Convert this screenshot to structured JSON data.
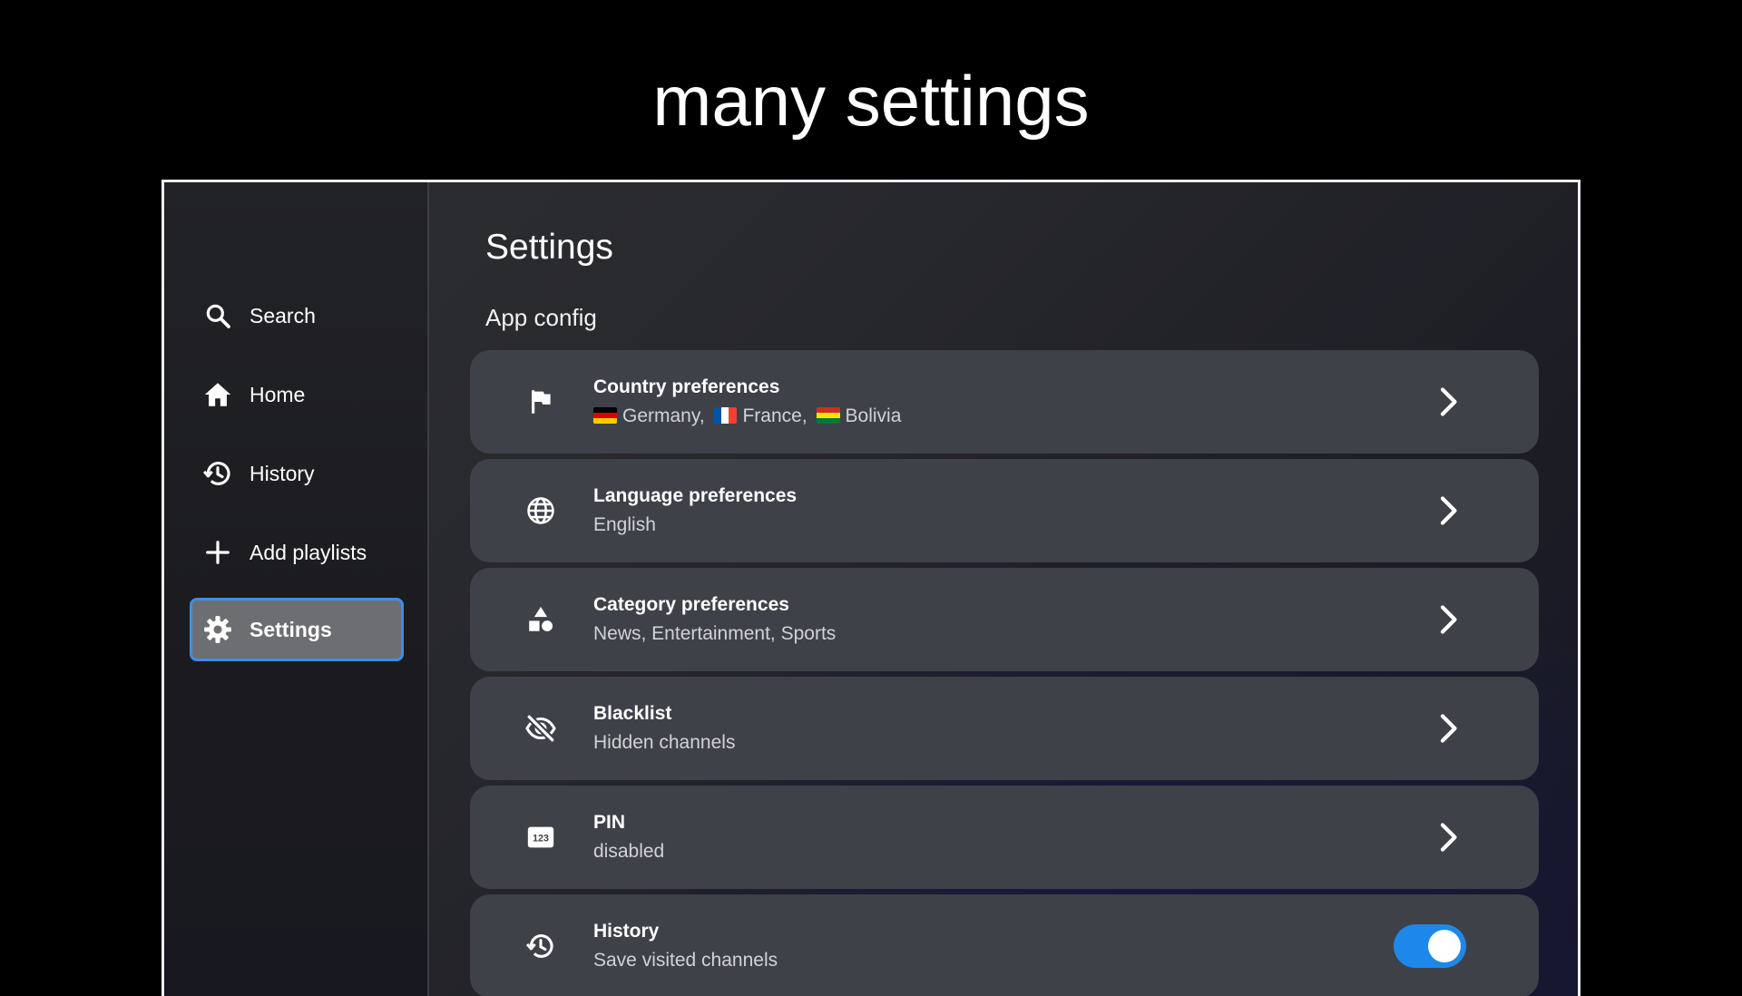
{
  "caption": "many settings",
  "sidebar": {
    "items": [
      {
        "label": "Search",
        "icon": "search-icon"
      },
      {
        "label": "Home",
        "icon": "home-icon"
      },
      {
        "label": "History",
        "icon": "history-icon"
      },
      {
        "label": "Add playlists",
        "icon": "plus-icon"
      },
      {
        "label": "Settings",
        "icon": "gear-icon",
        "active": true
      }
    ]
  },
  "main": {
    "title": "Settings",
    "section": "App config",
    "settings": [
      {
        "title": "Country preferences",
        "icon": "flag-icon",
        "countries": [
          {
            "name": "Germany",
            "flag": "germany-flag-icon"
          },
          {
            "name": "France",
            "flag": "france-flag-icon"
          },
          {
            "name": "Bolivia",
            "flag": "bolivia-flag-icon"
          }
        ]
      },
      {
        "title": "Language preferences",
        "subtitle": "English",
        "icon": "globe-icon"
      },
      {
        "title": "Category preferences",
        "subtitle": "News, Entertainment, Sports",
        "icon": "category-shapes-icon"
      },
      {
        "title": "Blacklist",
        "subtitle": "Hidden channels",
        "icon": "eye-off-icon"
      },
      {
        "title": "PIN",
        "subtitle": "disabled",
        "icon": "pin-123-icon",
        "icon_text": "123"
      },
      {
        "title": "History",
        "subtitle": "Save visited channels",
        "icon": "history-icon",
        "toggle_on": true
      }
    ]
  },
  "colors": {
    "accent": "#1e88ea",
    "active_border": "#3e8ee6",
    "card": "#3e4148"
  }
}
